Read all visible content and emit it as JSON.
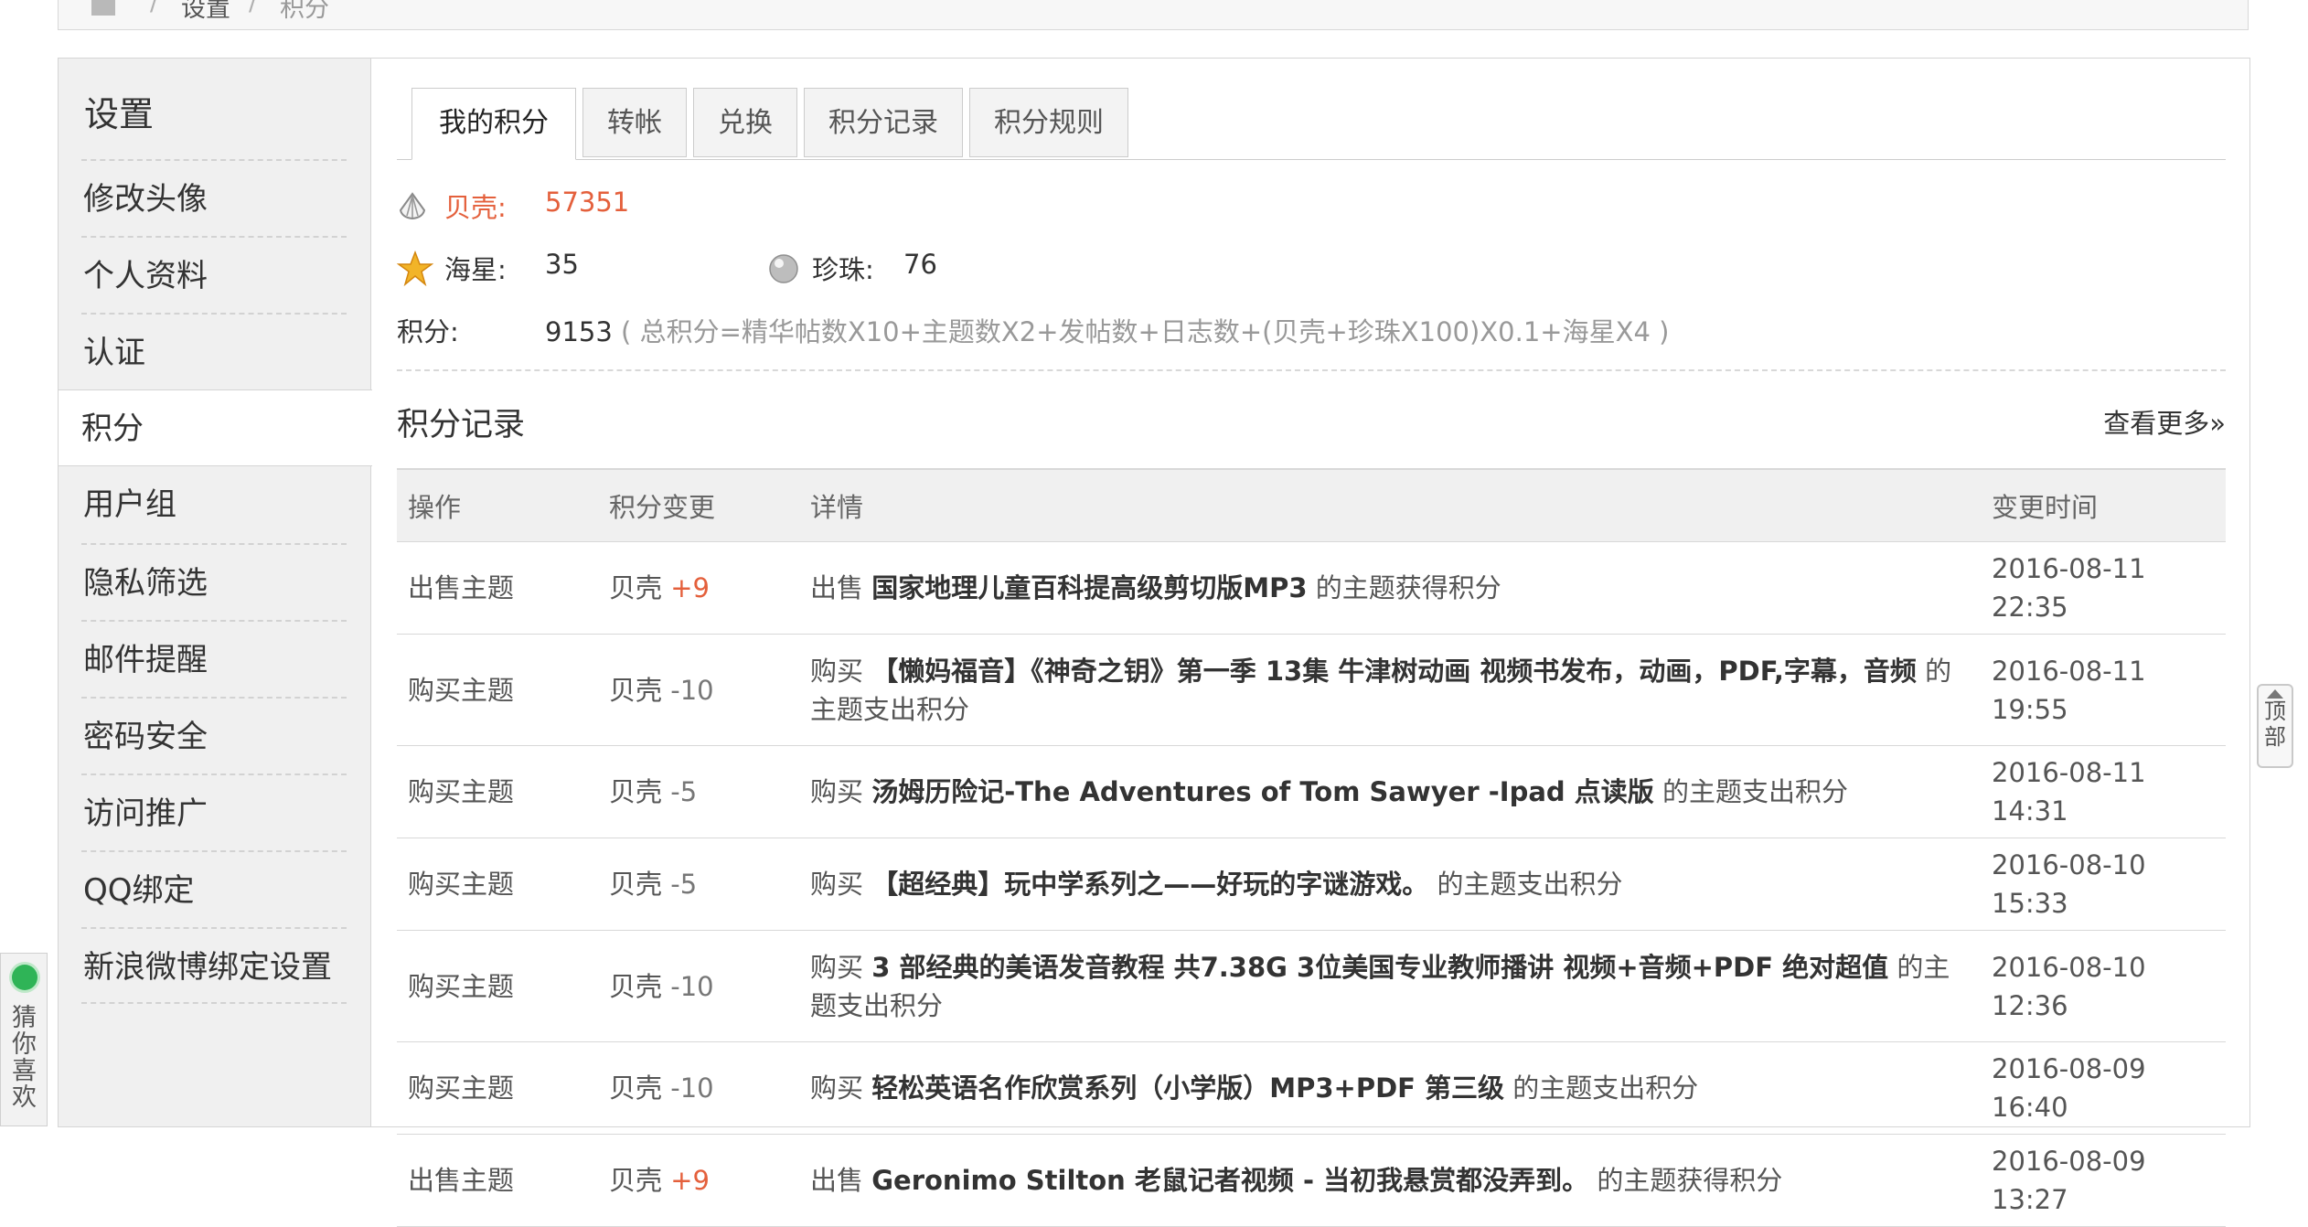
{
  "breadcrumb": {
    "items": [
      "设置",
      "积分"
    ],
    "separator": "/"
  },
  "sidebar": {
    "title": "设置",
    "items": [
      {
        "label": "修改头像",
        "active": false
      },
      {
        "label": "个人资料",
        "active": false
      },
      {
        "label": "认证",
        "active": false
      },
      {
        "label": "积分",
        "active": true
      },
      {
        "label": "用户组",
        "active": false
      },
      {
        "label": "隐私筛选",
        "active": false
      },
      {
        "label": "邮件提醒",
        "active": false
      },
      {
        "label": "密码安全",
        "active": false
      },
      {
        "label": "访问推广",
        "active": false
      },
      {
        "label": "QQ绑定",
        "active": false
      },
      {
        "label": "新浪微博绑定设置",
        "active": false
      }
    ]
  },
  "tabs": [
    {
      "label": "我的积分",
      "active": true
    },
    {
      "label": "转帐",
      "active": false
    },
    {
      "label": "兑换",
      "active": false
    },
    {
      "label": "积分记录",
      "active": false
    },
    {
      "label": "积分规则",
      "active": false
    }
  ],
  "credits": {
    "shell_label": "贝壳:",
    "shell_value": "57351",
    "star_label": "海星:",
    "star_value": "35",
    "pearl_label": "珍珠:",
    "pearl_value": "76",
    "points_label": "积分:",
    "points_value": "9153",
    "formula": "( 总积分=精华帖数X10+主题数X2+发帖数+日志数+(贝壳+珍珠X100)X0.1+海星X4 )"
  },
  "records": {
    "title": "积分记录",
    "more_link": "查看更多»",
    "columns": [
      "操作",
      "积分变更",
      "详情",
      "变更时间"
    ],
    "rows": [
      {
        "action": "出售主题",
        "unit": "贝壳",
        "change": "+9",
        "verb": "出售",
        "subject": "国家地理儿童百科提高级剪切版MP3",
        "suffix": "的主题获得积分",
        "time": "2016-08-11 22:35"
      },
      {
        "action": "购买主题",
        "unit": "贝壳",
        "change": "-10",
        "verb": "购买",
        "subject": "【懒妈福音】《神奇之钥》第一季 13集 牛津树动画 视频书发布，动画，PDF,字幕，音频",
        "suffix": "的主题支出积分",
        "time": "2016-08-11 19:55"
      },
      {
        "action": "购买主题",
        "unit": "贝壳",
        "change": "-5",
        "verb": "购买",
        "subject": "汤姆历险记-The Adventures of Tom Sawyer -Ipad 点读版",
        "suffix": "的主题支出积分",
        "time": "2016-08-11 14:31"
      },
      {
        "action": "购买主题",
        "unit": "贝壳",
        "change": "-5",
        "verb": "购买",
        "subject": "【超经典】玩中学系列之——好玩的字谜游戏。",
        "suffix": "的主题支出积分",
        "time": "2016-08-10 15:33"
      },
      {
        "action": "购买主题",
        "unit": "贝壳",
        "change": "-10",
        "verb": "购买",
        "subject": "3 部经典的美语发音教程 共7.38G 3位美国专业教师播讲 视频+音频+PDF 绝对超值",
        "suffix": "的主题支出积分",
        "time": "2016-08-10 12:36"
      },
      {
        "action": "购买主题",
        "unit": "贝壳",
        "change": "-10",
        "verb": "购买",
        "subject": "轻松英语名作欣赏系列（小学版）MP3+PDF 第三级",
        "suffix": "的主题支出积分",
        "time": "2016-08-09 16:40"
      },
      {
        "action": "出售主题",
        "unit": "贝壳",
        "change": "+9",
        "verb": "出售",
        "subject": "Geronimo Stilton 老鼠记者视频 - 当初我悬赏都没弄到。",
        "suffix": "的主题获得积分",
        "time": "2016-08-09 13:27"
      }
    ]
  },
  "float": {
    "top_button": "顶部",
    "guess_widget": "猜你喜欢"
  },
  "colors": {
    "accent_red": "#e4603c",
    "sidebar_bg": "#f0f0f0",
    "guess_dot": "#2fb457"
  }
}
